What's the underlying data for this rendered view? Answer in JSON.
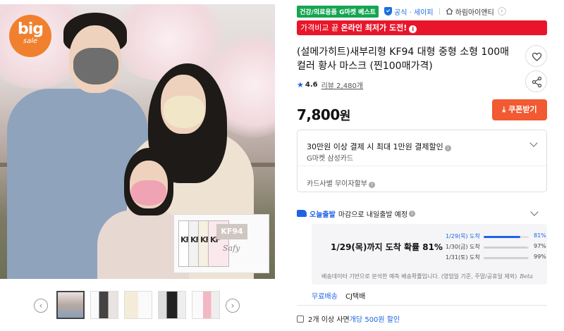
{
  "gallery": {
    "sale_badge_line1": "big",
    "sale_badge_line2": "sale",
    "pack_labels": [
      "KF",
      "KF",
      "KF",
      "KF"
    ],
    "pack_main_label": "KF94",
    "pack_brand": "Safy",
    "prev_arrow": "‹",
    "next_arrow": "›",
    "thumbnail_count": 5
  },
  "badges": {
    "category": "건강/의료용품 G마켓 베스트",
    "official": "공식 · 세이피",
    "store": "하림아이앤티",
    "store_arrow": "›"
  },
  "promo": {
    "prefix": "가격비교 끝 ",
    "strong": "온라인 최저가 도전!",
    "info_icon": "i"
  },
  "product": {
    "title": "(설메가히트)새부리형 KF94 대형 중형 소형 100매 컬러 황사 마스크 (찐100매가격)",
    "rating": "4.6",
    "review_label": "리뷰 2,480개",
    "price_value": "7,800",
    "price_unit": "원",
    "coupon_label": "쿠폰받기",
    "coupon_icon": "⤓"
  },
  "card_offer": {
    "title": "30만원 이상 결제 시 최대 1만원 결제할인",
    "card_name": "G마켓 삼성카드",
    "installment": "카드사별 무이자할부"
  },
  "delivery": {
    "today_label": "오늘출발",
    "today_text": "마감으로 내일출발 예정",
    "eta_main": "1/29(목)까지 도착 확률 81%",
    "eta_rows": [
      {
        "date": "1/29(목) 도착",
        "pct": "81%",
        "value": 0.81
      },
      {
        "date": "1/30(금) 도착",
        "pct": "97%",
        "value": 0.97
      },
      {
        "date": "1/31(토) 도착",
        "pct": "99%",
        "value": 0.99
      }
    ],
    "note": "배송데이터 기반으로 분석한 예측 배송확률입니다. (영업일 기준, 주말/공휴일 제외)",
    "beta": "Beta",
    "free_shipping": "무료배송",
    "courier": "CJ택배"
  },
  "multi_buy": {
    "text": "2개 이상 사면 ",
    "highlight": "개당 500원 할인"
  }
}
